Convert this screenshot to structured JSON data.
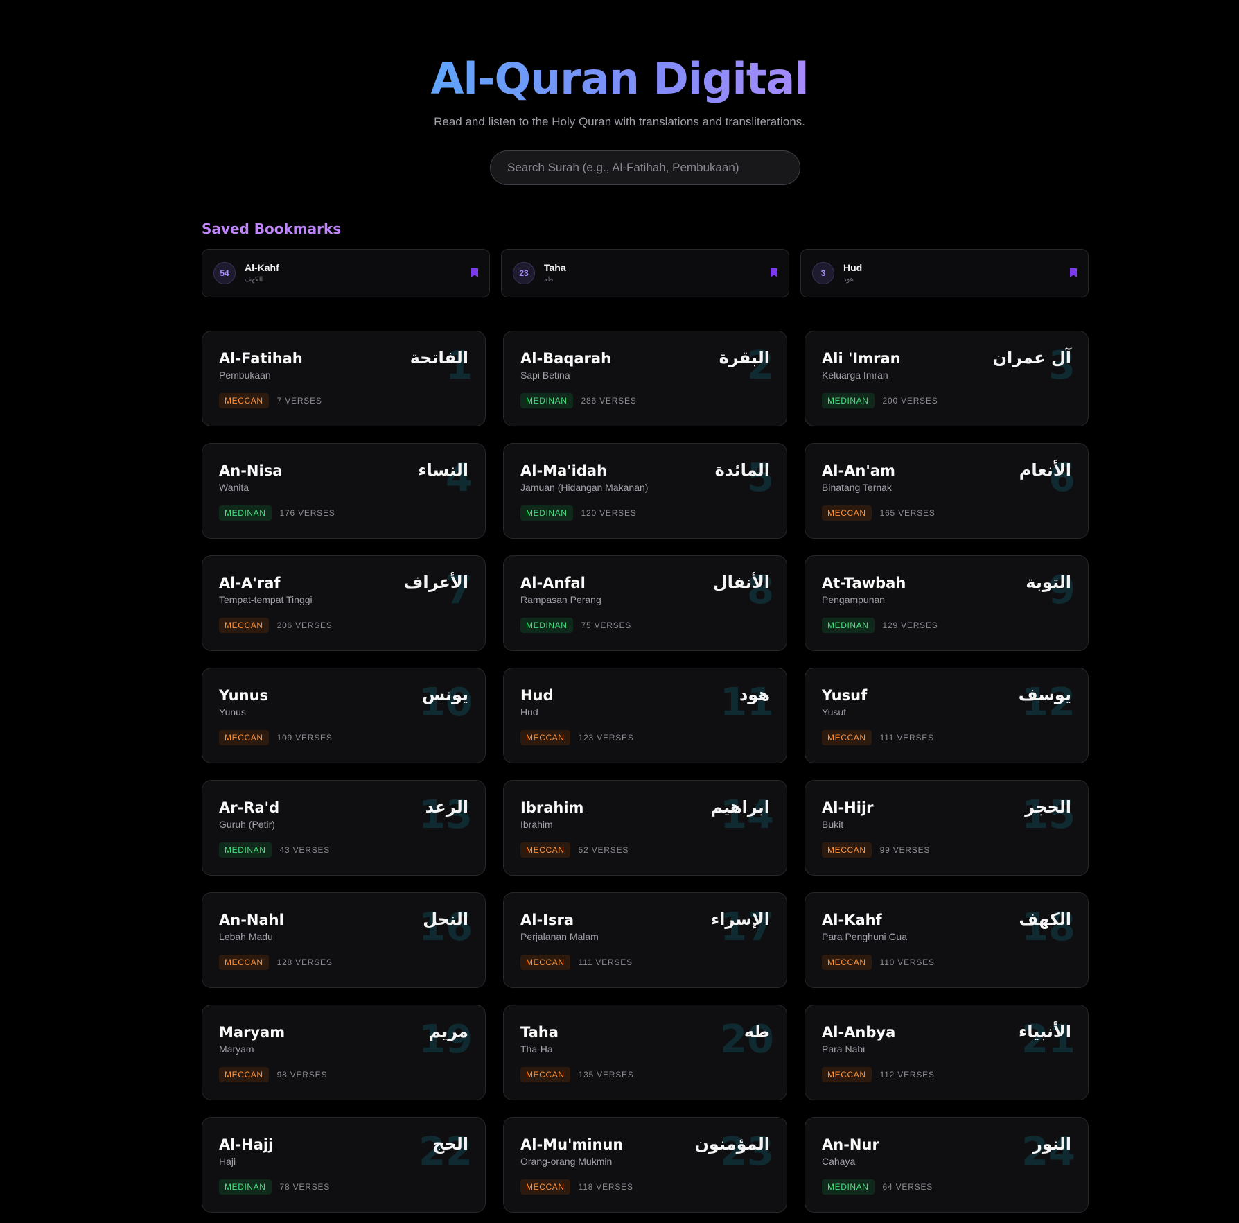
{
  "header": {
    "title": "Al-Quran Digital",
    "subtitle": "Read and listen to the Holy Quran with translations and transliterations."
  },
  "search": {
    "placeholder": "Search Surah (e.g., Al-Fatihah, Pembukaan)",
    "value": ""
  },
  "bookmarks": {
    "heading": "Saved Bookmarks",
    "items": [
      {
        "number": "54",
        "name": "Al-Kahf",
        "arabic": "الكهف",
        "icon": "bookmark-icon"
      },
      {
        "number": "23",
        "name": "Taha",
        "arabic": "طه",
        "icon": "bookmark-icon"
      },
      {
        "number": "3",
        "name": "Hud",
        "arabic": "هود",
        "icon": "bookmark-icon"
      }
    ]
  },
  "colors": {
    "accent": "#a78bfa",
    "meccan": "#fb923c",
    "medinan": "#4ade80",
    "background": "#000000"
  },
  "surahs": [
    {
      "number": "1",
      "name": "Al-Fatihah",
      "translation": "Pembukaan",
      "arabic": "الفاتحة",
      "type": "MECCAN",
      "verses": "7 VERSES"
    },
    {
      "number": "2",
      "name": "Al-Baqarah",
      "translation": "Sapi Betina",
      "arabic": "البقرة",
      "type": "MEDINAN",
      "verses": "286 VERSES"
    },
    {
      "number": "3",
      "name": "Ali 'Imran",
      "translation": "Keluarga Imran",
      "arabic": "آل عمران",
      "type": "MEDINAN",
      "verses": "200 VERSES"
    },
    {
      "number": "4",
      "name": "An-Nisa",
      "translation": "Wanita",
      "arabic": "النساء",
      "type": "MEDINAN",
      "verses": "176 VERSES"
    },
    {
      "number": "5",
      "name": "Al-Ma'idah",
      "translation": "Jamuan (Hidangan Makanan)",
      "arabic": "المائدة",
      "type": "MEDINAN",
      "verses": "120 VERSES"
    },
    {
      "number": "6",
      "name": "Al-An'am",
      "translation": "Binatang Ternak",
      "arabic": "الأنعام",
      "type": "MECCAN",
      "verses": "165 VERSES"
    },
    {
      "number": "7",
      "name": "Al-A'raf",
      "translation": "Tempat-tempat Tinggi",
      "arabic": "الأعراف",
      "type": "MECCAN",
      "verses": "206 VERSES"
    },
    {
      "number": "8",
      "name": "Al-Anfal",
      "translation": "Rampasan Perang",
      "arabic": "الأنفال",
      "type": "MEDINAN",
      "verses": "75 VERSES"
    },
    {
      "number": "9",
      "name": "At-Tawbah",
      "translation": "Pengampunan",
      "arabic": "التوبة",
      "type": "MEDINAN",
      "verses": "129 VERSES"
    },
    {
      "number": "10",
      "name": "Yunus",
      "translation": "Yunus",
      "arabic": "يونس",
      "type": "MECCAN",
      "verses": "109 VERSES"
    },
    {
      "number": "11",
      "name": "Hud",
      "translation": "Hud",
      "arabic": "هود",
      "type": "MECCAN",
      "verses": "123 VERSES"
    },
    {
      "number": "12",
      "name": "Yusuf",
      "translation": "Yusuf",
      "arabic": "يوسف",
      "type": "MECCAN",
      "verses": "111 VERSES"
    },
    {
      "number": "13",
      "name": "Ar-Ra'd",
      "translation": "Guruh (Petir)",
      "arabic": "الرعد",
      "type": "MEDINAN",
      "verses": "43 VERSES"
    },
    {
      "number": "14",
      "name": "Ibrahim",
      "translation": "Ibrahim",
      "arabic": "ابراهيم",
      "type": "MECCAN",
      "verses": "52 VERSES"
    },
    {
      "number": "15",
      "name": "Al-Hijr",
      "translation": "Bukit",
      "arabic": "الحجر",
      "type": "MECCAN",
      "verses": "99 VERSES"
    },
    {
      "number": "16",
      "name": "An-Nahl",
      "translation": "Lebah Madu",
      "arabic": "النحل",
      "type": "MECCAN",
      "verses": "128 VERSES"
    },
    {
      "number": "17",
      "name": "Al-Isra",
      "translation": "Perjalanan Malam",
      "arabic": "الإسراء",
      "type": "MECCAN",
      "verses": "111 VERSES"
    },
    {
      "number": "18",
      "name": "Al-Kahf",
      "translation": "Para Penghuni Gua",
      "arabic": "الكهف",
      "type": "MECCAN",
      "verses": "110 VERSES"
    },
    {
      "number": "19",
      "name": "Maryam",
      "translation": "Maryam",
      "arabic": "مريم",
      "type": "MECCAN",
      "verses": "98 VERSES"
    },
    {
      "number": "20",
      "name": "Taha",
      "translation": "Tha-Ha",
      "arabic": "طه",
      "type": "MECCAN",
      "verses": "135 VERSES"
    },
    {
      "number": "21",
      "name": "Al-Anbya",
      "translation": "Para Nabi",
      "arabic": "الأنبياء",
      "type": "MECCAN",
      "verses": "112 VERSES"
    },
    {
      "number": "22",
      "name": "Al-Hajj",
      "translation": "Haji",
      "arabic": "الحج",
      "type": "MEDINAN",
      "verses": "78 VERSES"
    },
    {
      "number": "23",
      "name": "Al-Mu'minun",
      "translation": "Orang-orang Mukmin",
      "arabic": "المؤمنون",
      "type": "MECCAN",
      "verses": "118 VERSES"
    },
    {
      "number": "24",
      "name": "An-Nur",
      "translation": "Cahaya",
      "arabic": "النور",
      "type": "MEDINAN",
      "verses": "64 VERSES"
    }
  ]
}
